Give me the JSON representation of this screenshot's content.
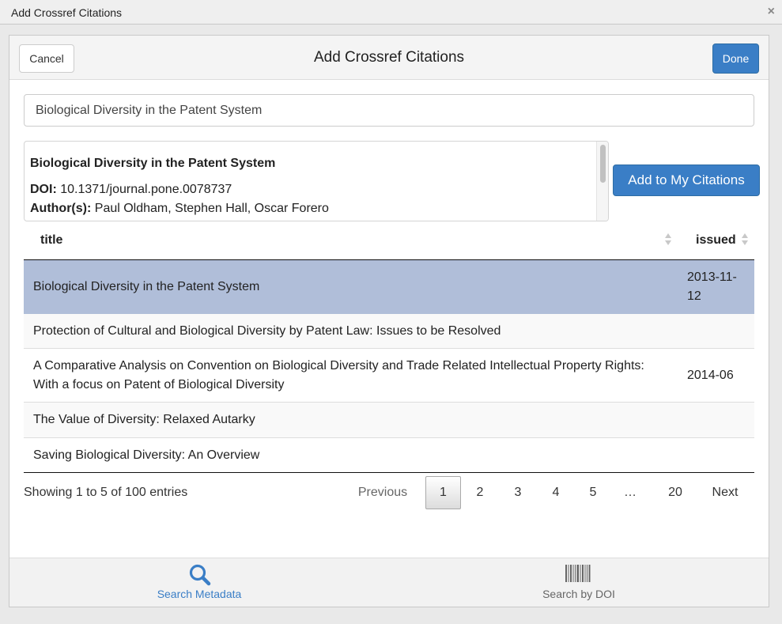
{
  "window": {
    "title": "Add Crossref Citations",
    "close_glyph": "×"
  },
  "dialog": {
    "title": "Add Crossref Citations",
    "cancel_label": "Cancel",
    "done_label": "Done"
  },
  "search": {
    "value": "Biological Diversity in the Patent System"
  },
  "preview": {
    "title": "Biological Diversity in the Patent System",
    "doi_label": "DOI:",
    "doi": "10.1371/journal.pone.0078737",
    "authors_label": "Author(s):",
    "authors": "Paul Oldham, Stephen Hall, Oscar Forero"
  },
  "add_button_label": "Add to My Citations",
  "table": {
    "columns": [
      "title",
      "issued"
    ],
    "rows": [
      {
        "title": "Biological Diversity in the Patent System",
        "issued": "2013-11-12",
        "selected": true
      },
      {
        "title": "Protection of Cultural and Biological Diversity by Patent Law: Issues to be Resolved",
        "issued": ""
      },
      {
        "title": "A Comparative Analysis on Convention on Biological Diversity and Trade Related Intellectual Property Rights: With a focus on Patent of Biological Diversity",
        "issued": "2014-06"
      },
      {
        "title": "The Value of Diversity: Relaxed Autarky",
        "issued": ""
      },
      {
        "title": "Saving Biological Diversity: An Overview",
        "issued": ""
      }
    ]
  },
  "pagination": {
    "info": "Showing 1 to 5 of 100 entries",
    "previous": "Previous",
    "pages": [
      "1",
      "2",
      "3",
      "4",
      "5",
      "…",
      "20"
    ],
    "current": "1",
    "next": "Next"
  },
  "footer_tabs": [
    {
      "label": "Search Metadata",
      "icon": "search-icon",
      "active": true
    },
    {
      "label": "Search by DOI",
      "icon": "barcode-icon",
      "active": false
    }
  ],
  "colors": {
    "primary": "#3a7ec6",
    "selected_row": "#b0bed9"
  }
}
